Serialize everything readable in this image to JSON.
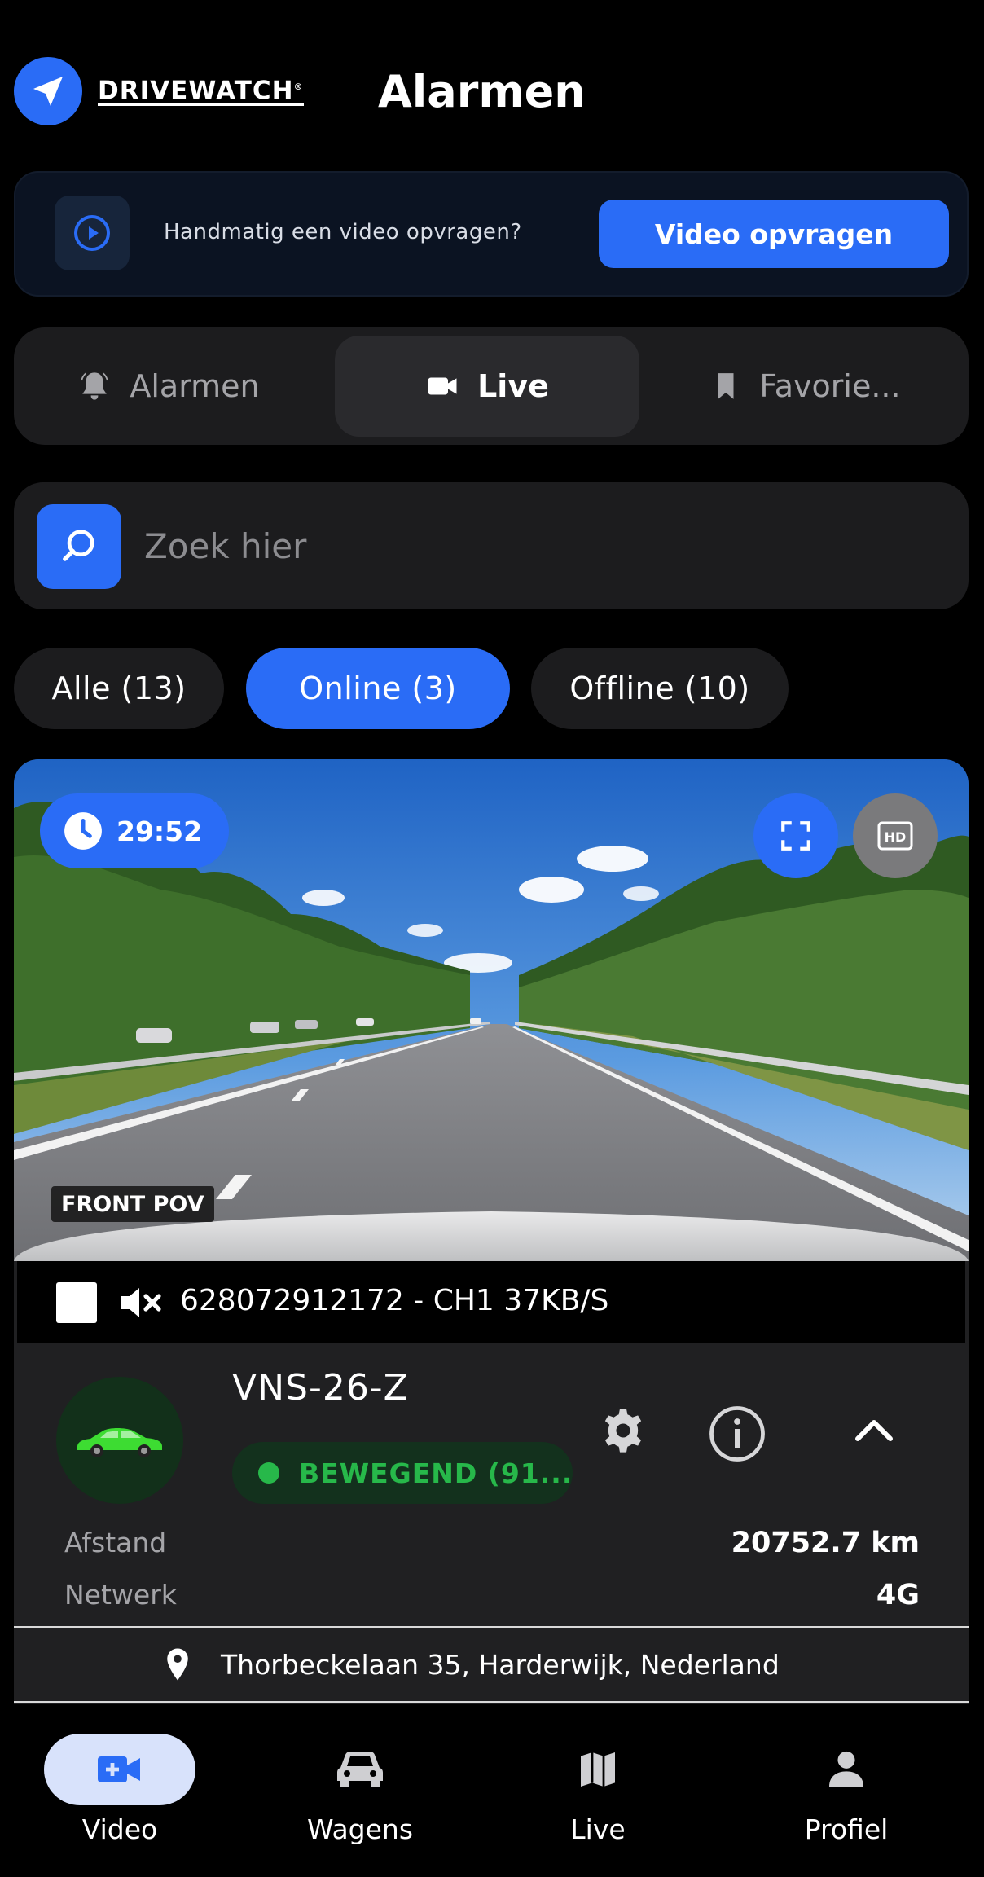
{
  "header": {
    "brand": "DRIVEWATCH",
    "brand_mark": "®",
    "title": "Alarmen"
  },
  "request": {
    "text": "Handmatig een video opvragen?",
    "button_label": "Video opvragen"
  },
  "tabs": [
    {
      "label": "Alarmen",
      "icon": "bell-icon",
      "active": false
    },
    {
      "label": "Live",
      "icon": "video-camera-icon",
      "active": true
    },
    {
      "label": "Favorie...",
      "icon": "bookmark-icon",
      "active": false
    }
  ],
  "search": {
    "placeholder": "Zoek hier"
  },
  "filters": [
    {
      "label": "Alle (13)",
      "active": false
    },
    {
      "label": "Online (3)",
      "active": true
    },
    {
      "label": "Offline (10)",
      "active": false
    }
  ],
  "video": {
    "timer": "29:52",
    "camera_label": "FRONT POV",
    "hd_label": "HD",
    "stream_info": "628072912172 - CH1 37KB/S"
  },
  "vehicle": {
    "plate": "VNS-26-Z",
    "status": "BEWEGEND (91...",
    "details": [
      {
        "label": "Afstand",
        "value": "20752.7 km"
      },
      {
        "label": "Netwerk",
        "value": "4G"
      }
    ],
    "address": "Thorbeckelaan 35, Harderwijk, Nederland"
  },
  "nav": [
    {
      "label": "Video",
      "icon": "video-plus-icon",
      "active": true
    },
    {
      "label": "Wagens",
      "icon": "car-icon",
      "active": false
    },
    {
      "label": "Live",
      "icon": "map-icon",
      "active": false
    },
    {
      "label": "Profiel",
      "icon": "person-icon",
      "active": false
    }
  ],
  "colors": {
    "accent": "#2a6cf6",
    "background": "#000000",
    "surface": "#1c1c1e",
    "status_green": "#27b84a"
  }
}
